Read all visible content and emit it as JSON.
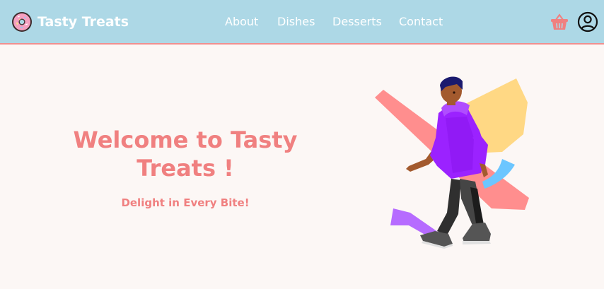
{
  "brand": {
    "name": "Tasty Treats",
    "logo_icon": "donut-icon"
  },
  "nav": {
    "links": [
      "About",
      "Dishes",
      "Desserts",
      "Contact"
    ]
  },
  "header_icons": {
    "cart": "shopping-basket-icon",
    "account": "user-circle-icon"
  },
  "hero": {
    "title": "Welcome to Tasty Treats !",
    "subtitle": "Delight in Every Bite!",
    "illustration": "walking-person-illustration"
  },
  "colors": {
    "header_bg": "#add8e6",
    "header_border": "#f08f8f",
    "accent": "#f08080",
    "page_bg": "#fcf7f5"
  }
}
